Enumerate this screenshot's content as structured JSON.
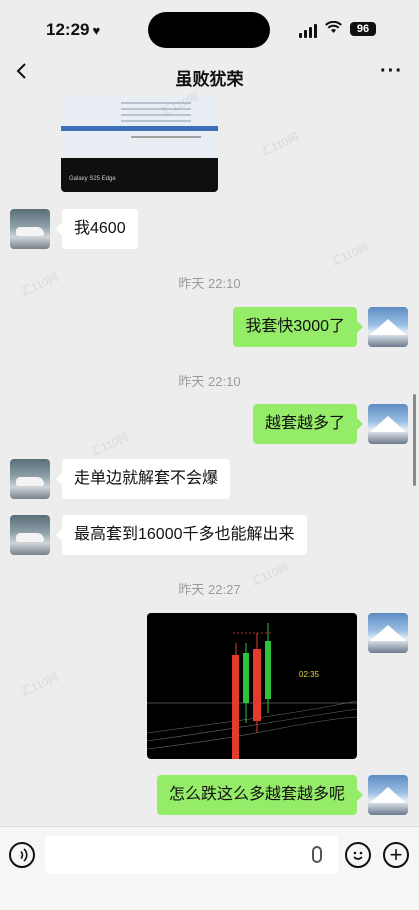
{
  "status": {
    "time": "12:29",
    "battery": "96"
  },
  "nav": {
    "title": "虽败犹荣"
  },
  "top_image": {
    "caption": "Galaxy S25 Edge"
  },
  "messages": [
    {
      "side": "in",
      "text": "我4600"
    },
    {
      "side": "stamp",
      "text": "昨天 22:10"
    },
    {
      "side": "out",
      "text": "我套快3000了"
    },
    {
      "side": "stamp",
      "text": "昨天 22:10"
    },
    {
      "side": "out",
      "text": "越套越多了"
    },
    {
      "side": "in",
      "text": "走单边就解套不会爆"
    },
    {
      "side": "in",
      "text": "最高套到16000千多也能解出来"
    },
    {
      "side": "stamp",
      "text": "昨天 22:27"
    },
    {
      "side": "out",
      "text": "怎么跌这么多越套越多呢"
    }
  ],
  "chart_image": {
    "timer": "02:35"
  },
  "watermark": "汇110网",
  "icons": {
    "back": "chevron-left-icon",
    "more": "more-icon",
    "voice": "voice-icon",
    "mic": "mic-icon",
    "emoji": "emoji-icon",
    "plus": "plus-icon"
  }
}
